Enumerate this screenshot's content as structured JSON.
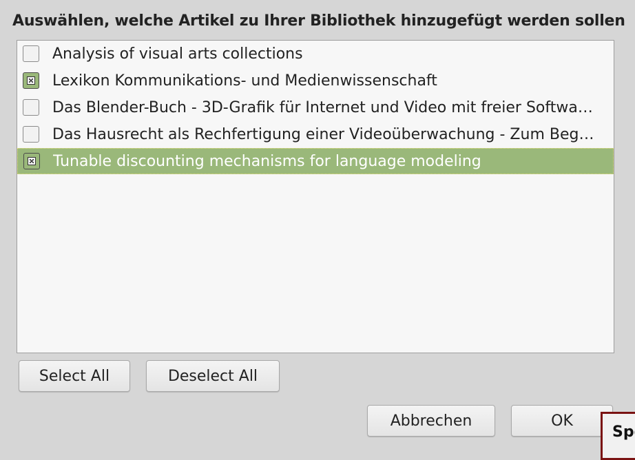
{
  "dialog": {
    "title": "Auswählen, welche Artikel zu Ihrer Bibliothek hinzugefügt werden sollen"
  },
  "items": [
    {
      "label": "Analysis of visual arts collections",
      "checked": false,
      "selected": false
    },
    {
      "label": "Lexikon Kommunikations- und Medienwissenschaft",
      "checked": true,
      "selected": false
    },
    {
      "label": "Das Blender-Buch - 3D-Grafik für Internet und Video mit freier Softwa…",
      "checked": false,
      "selected": false
    },
    {
      "label": "Das Hausrecht als Rechfertigung einer Videoüberwachung - Zum Beg…",
      "checked": false,
      "selected": false
    },
    {
      "label": "Tunable discounting mechanisms for language modeling",
      "checked": true,
      "selected": true
    }
  ],
  "buttons": {
    "select_all": "Select All",
    "deselect_all": "Deselect All",
    "cancel": "Abbrechen",
    "ok": "OK"
  },
  "tooltip": {
    "text": "Spe"
  },
  "colors": {
    "background": "#d6d6d6",
    "list_background": "#f7f7f7",
    "selection": "#9ab87a",
    "tooltip_border": "#7a1212"
  }
}
